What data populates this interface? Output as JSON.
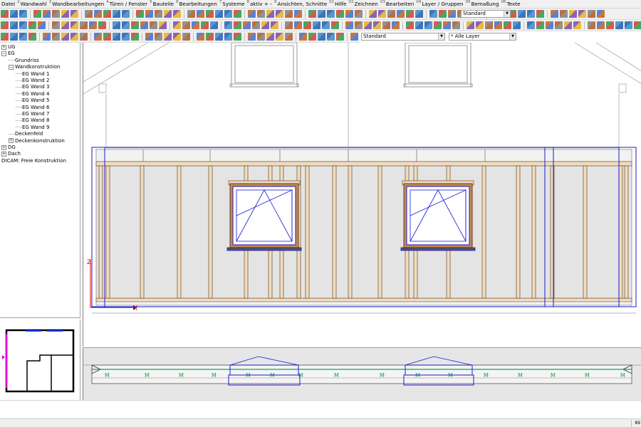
{
  "menu": [
    {
      "num": "",
      "label": "Datei"
    },
    {
      "num": "2",
      "label": "Wandwahl"
    },
    {
      "num": "3",
      "label": "Wandbearbeitungen"
    },
    {
      "num": "4",
      "label": "Türen / Fenster"
    },
    {
      "num": "5",
      "label": "Bauteile"
    },
    {
      "num": "6",
      "label": "Bearbeitungen"
    },
    {
      "num": "7",
      "label": "Systeme"
    },
    {
      "num": "8",
      "label": "aktiv + -"
    },
    {
      "num": "9",
      "label": "Ansichten, Schnitte"
    },
    {
      "num": "01",
      "label": "Hilfe"
    },
    {
      "num": "02",
      "label": "Zeichnen"
    },
    {
      "num": "03",
      "label": "Bearbeiten"
    },
    {
      "num": "04",
      "label": "Layer / Gruppen"
    },
    {
      "num": "05",
      "label": "Bemaßung"
    },
    {
      "num": "06",
      "label": "Texte"
    }
  ],
  "toolbar": {
    "linestyle_combo": "Standard",
    "style_combo": "Standard",
    "layer_combo": "* Alle Layer"
  },
  "tree": [
    {
      "label": "UG",
      "box": "+",
      "indent": 0
    },
    {
      "label": "EG",
      "box": "−",
      "indent": 0
    },
    {
      "label": "Grundriss",
      "box": "",
      "indent": 1
    },
    {
      "label": "Wandkonstruktion",
      "box": "−",
      "indent": 1
    },
    {
      "label": "EG Wand 1",
      "box": "",
      "indent": 2
    },
    {
      "label": "EG Wand 2",
      "box": "",
      "indent": 2
    },
    {
      "label": "EG Wand 3",
      "box": "",
      "indent": 2
    },
    {
      "label": "EG Wand 4",
      "box": "",
      "indent": 2
    },
    {
      "label": "EG Wand 5",
      "box": "",
      "indent": 2
    },
    {
      "label": "EG Wand 6",
      "box": "",
      "indent": 2
    },
    {
      "label": "EG Wand 7",
      "box": "",
      "indent": 2
    },
    {
      "label": "EG Wand 8",
      "box": "",
      "indent": 2
    },
    {
      "label": "EG Wand 9",
      "box": "",
      "indent": 2
    },
    {
      "label": "Deckenfeld",
      "box": "",
      "indent": 1
    },
    {
      "label": "Deckenkonstruktion",
      "box": "+",
      "indent": 1
    },
    {
      "label": "DG",
      "box": "+",
      "indent": 0
    },
    {
      "label": "Dach",
      "box": "+",
      "indent": 0
    },
    {
      "label": "DICAM: Freie Konstruktion",
      "box": "",
      "indent": 0
    }
  ],
  "axes": {
    "z_label": "Z",
    "x_label": "X"
  },
  "status": {
    "right_text": "89"
  },
  "colors": {
    "wall_fill": "#e4e4e4",
    "stud_fill": "#f0dcc0",
    "stud_stroke": "#6b4a2a",
    "selection_blue": "#1a1acc",
    "plan_green": "#1aa05a",
    "accent_magenta": "#e000e0",
    "axis_red": "#e00000"
  }
}
